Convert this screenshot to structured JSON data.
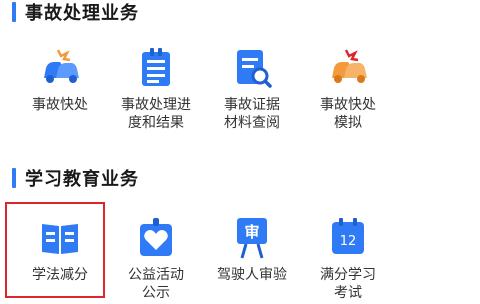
{
  "sections": [
    {
      "title": "事故处理业务",
      "items": [
        {
          "label": "事故快处",
          "icon": "car-crash-icon"
        },
        {
          "label": "事故处理进\n度和结果",
          "icon": "document-list-icon"
        },
        {
          "label": "事故证据\n材料查阅",
          "icon": "document-search-icon"
        },
        {
          "label": "事故快处\n模拟",
          "icon": "car-crash-orange-icon"
        }
      ]
    },
    {
      "title": "学习教育业务",
      "items": [
        {
          "label": "学法减分",
          "icon": "open-book-icon"
        },
        {
          "label": "公益活动\n公示",
          "icon": "heart-hands-icon"
        },
        {
          "label": "驾驶人审验",
          "icon": "review-board-icon"
        },
        {
          "label": "满分学习\n考试",
          "icon": "calendar-12-icon"
        }
      ]
    }
  ],
  "calendar_icon_text": "12",
  "review_icon_text": "审",
  "colors": {
    "accent": "#2f7bf5",
    "orange": "#f39a3a",
    "highlight": "#e0242b"
  }
}
